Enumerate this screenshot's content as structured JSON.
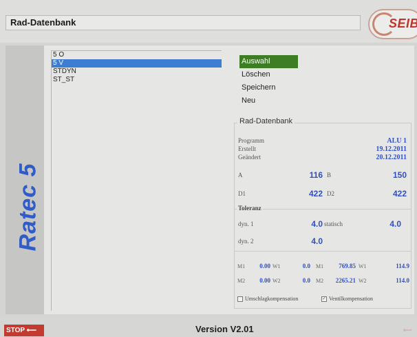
{
  "window": {
    "title": "Rad-Datenbank"
  },
  "logo": {
    "text": "SEIB"
  },
  "brand": {
    "text": "Ratec 5"
  },
  "list": {
    "items": [
      {
        "label": "5 O",
        "selected": false
      },
      {
        "label": "5 V",
        "selected": true
      },
      {
        "label": "STDYN",
        "selected": false
      },
      {
        "label": "ST_ST",
        "selected": false
      }
    ]
  },
  "menu": {
    "auswahl": "Auswahl",
    "loeschen": "Löschen",
    "speichern": "Speichern",
    "neu": "Neu"
  },
  "details": {
    "group_title": "Rad-Datenbank",
    "programm_label": "Programm",
    "programm_value": "ALU 1",
    "erstellt_label": "Erstellt",
    "erstellt_value": "19.12.2011",
    "geaendert_label": "Geändert",
    "geaendert_value": "20.12.2011",
    "a_label": "A",
    "a_value": "116",
    "b_label": "B",
    "b_value": "150",
    "d1_label": "D1",
    "d1_value": "422",
    "d2_label": "D2",
    "d2_value": "422",
    "toleranz": {
      "title": "Toleranz",
      "dyn1_label": "dyn. 1",
      "dyn1_value": "4.0",
      "statisch_label": "statisch",
      "statisch_value": "4.0",
      "dyn2_label": "dyn. 2",
      "dyn2_value": "4.0"
    },
    "measure": {
      "m1_label": "M1",
      "m1_value": "0.00",
      "w1_label": "W1",
      "w1_value": "0.0",
      "m1b_label": "M1",
      "m1b_value": "769.85",
      "w1b_label": "W1",
      "w1b_value": "114.9",
      "m2_label": "M2",
      "m2_value": "0.00",
      "w2_label": "W2",
      "w2_value": "0.0",
      "m2b_label": "M2",
      "m2b_value": "2265.21",
      "w2b_label": "W2",
      "w2b_value": "114.0"
    },
    "checks": {
      "umschlag_label": "Umschlagkompensation",
      "umschlag_checked": false,
      "ventil_label": "Ventilkompensation",
      "ventil_checked": true
    }
  },
  "footer": {
    "stop_label": "STOP ⟵",
    "version": "Version V2.01"
  },
  "colors": {
    "accent_green": "#3d7d24",
    "selection_blue": "#3d7ed3",
    "stop_red": "#c23a30",
    "value_blue": "#2f4fc8"
  }
}
